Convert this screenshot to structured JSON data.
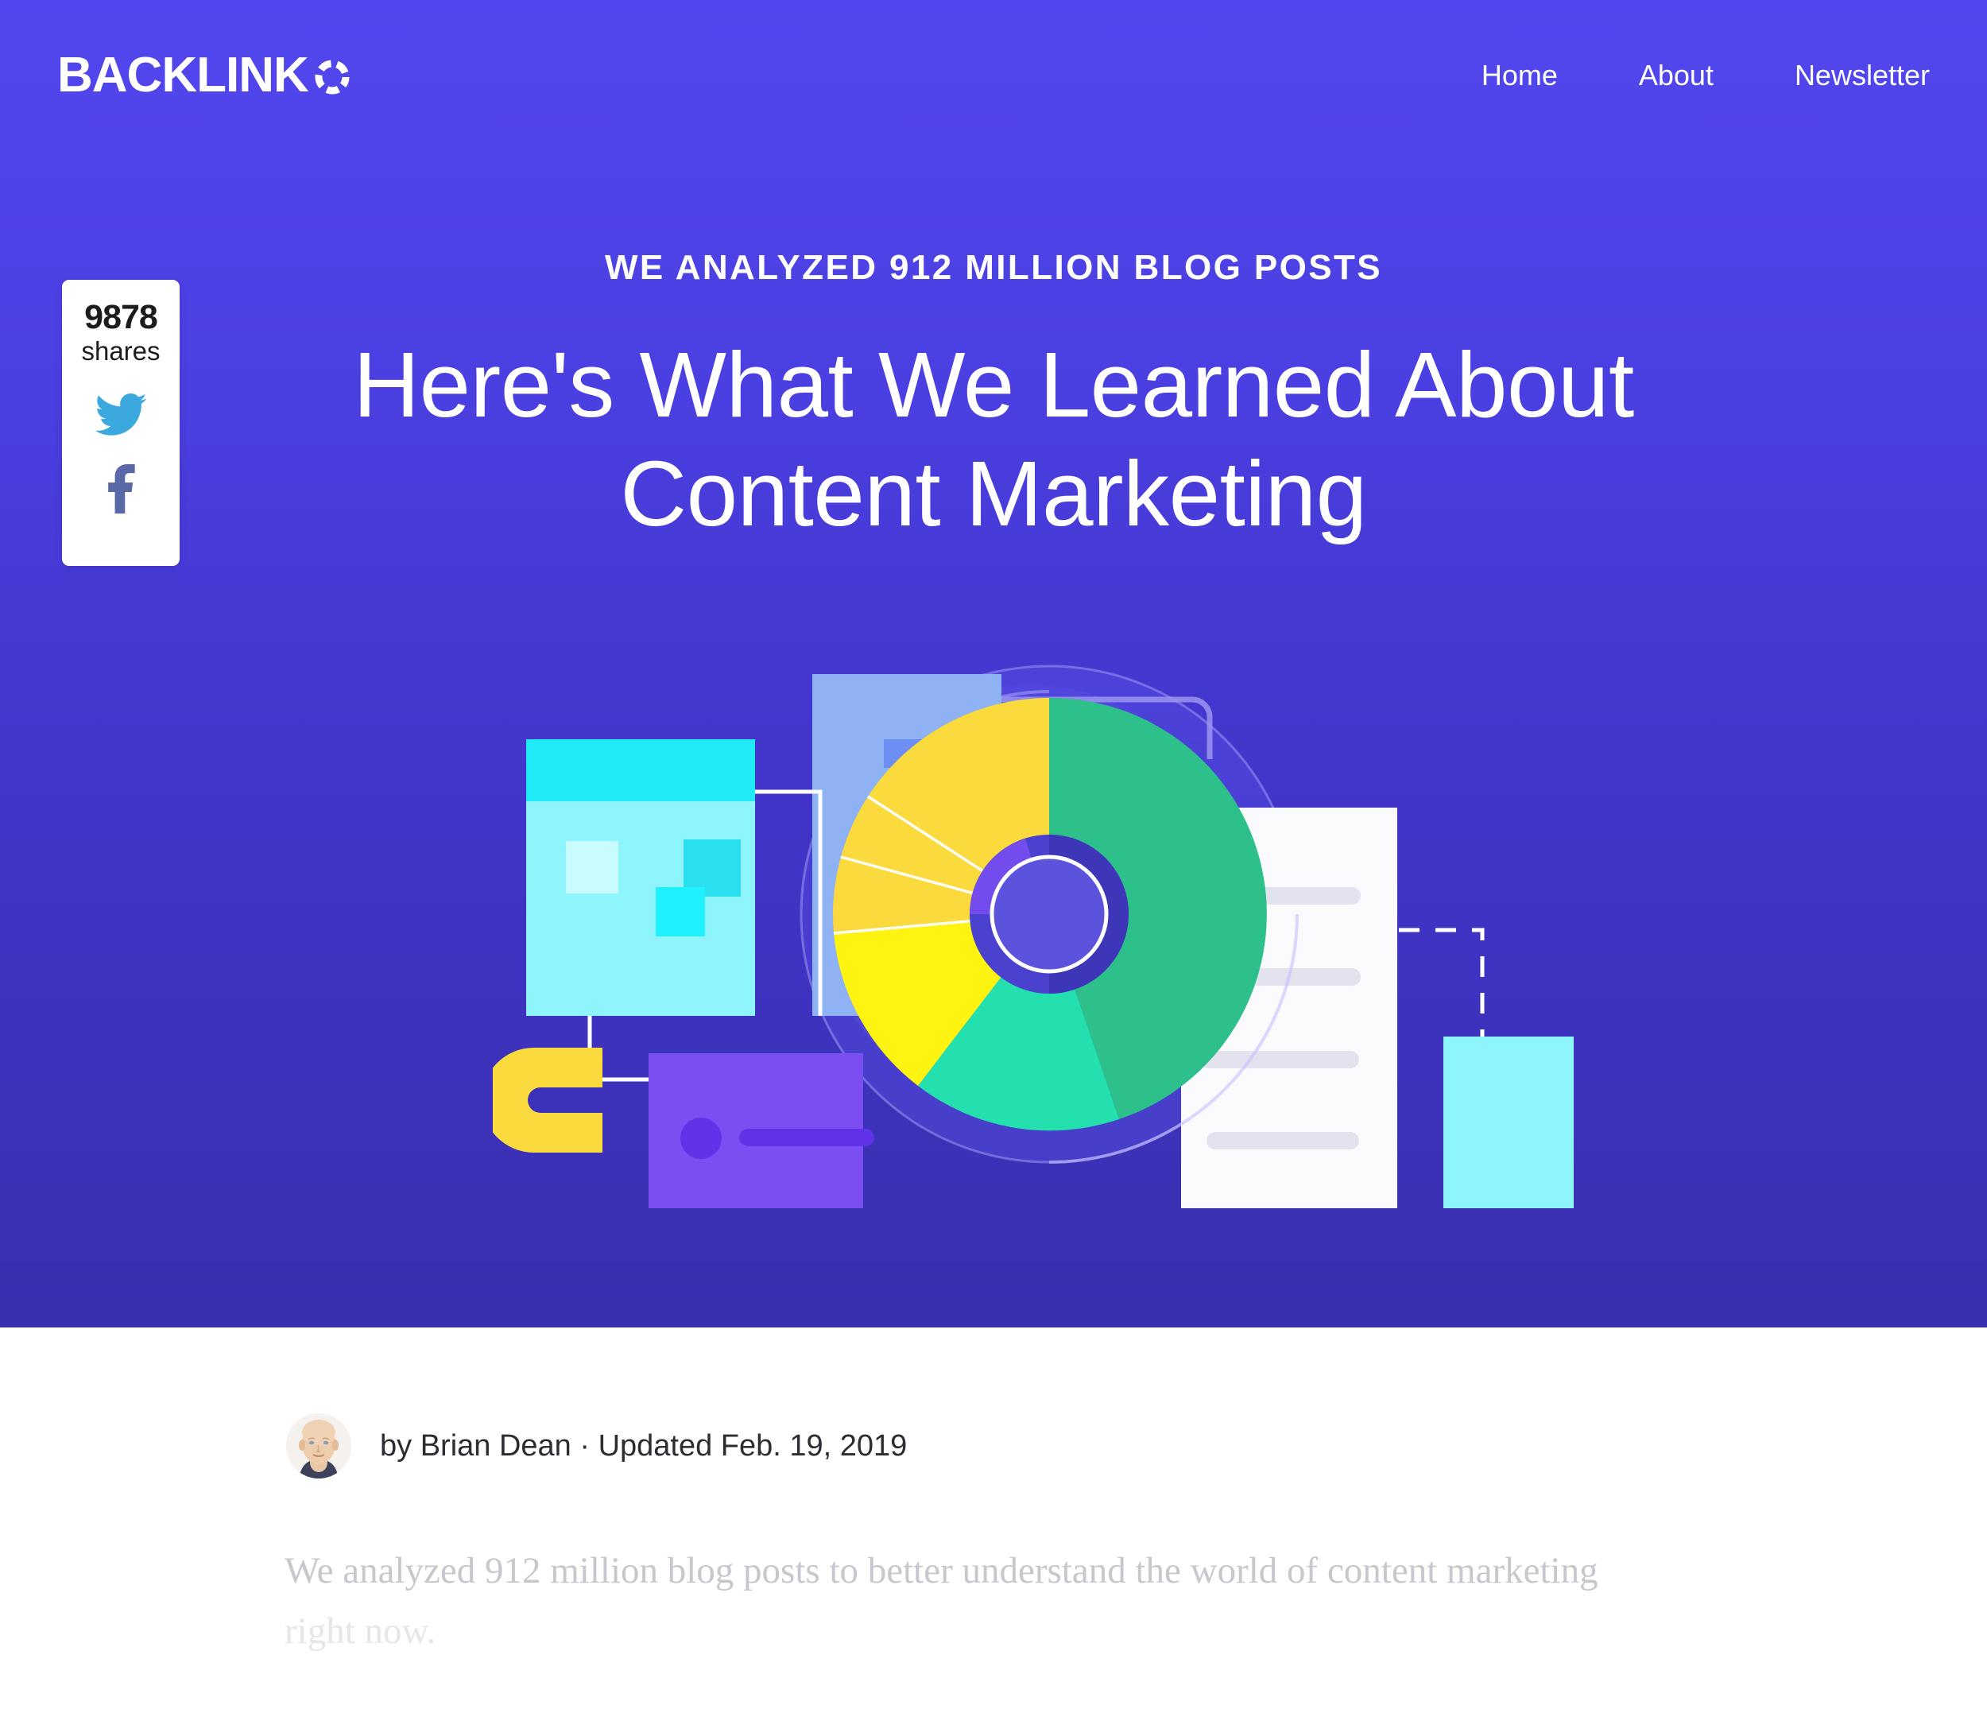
{
  "site": {
    "logo_text": "BACKLINK",
    "logo_mark_icon": "segmented-circle-o-icon"
  },
  "nav": {
    "items": [
      {
        "label": "Home"
      },
      {
        "label": "About"
      },
      {
        "label": "Newsletter"
      }
    ]
  },
  "share": {
    "count": "9878",
    "label": "shares",
    "twitter_icon": "twitter-bird-icon",
    "facebook_icon": "facebook-f-icon",
    "twitter_color": "#3ba9dd",
    "facebook_color": "#5a68a8"
  },
  "hero": {
    "eyebrow": "WE ANALYZED 912 MILLION BLOG POSTS",
    "headline_line1": "Here's What We Learned About",
    "headline_line2": "Content Marketing",
    "bg_top_color": "#5247ee",
    "bg_bottom_color": "#3830ae",
    "illustration_name": "content-marketing-analytics-illustration"
  },
  "article": {
    "avatar_icon": "author-avatar",
    "byline": "by Brian Dean · Updated Feb. 19, 2019",
    "lede_line1": "We analyzed 912 million blog posts to better understand the world of content marketing",
    "lede_line2": "right now."
  },
  "chart_data": {
    "type": "pie",
    "title": "Content Marketing Analysis",
    "categories": [
      "Green segment",
      "Gold segment A",
      "Gold segment B",
      "Gold segment C",
      "Bright yellow segment",
      "Teal segment"
    ],
    "values": [
      46,
      10,
      7,
      7,
      16,
      14
    ],
    "colors": [
      "#2ec08b",
      "#fada3c",
      "#fada3c",
      "#fada3c",
      "#fff312",
      "#24dfae"
    ],
    "donut_hole_color": "#4e45cc",
    "legend": "none"
  }
}
